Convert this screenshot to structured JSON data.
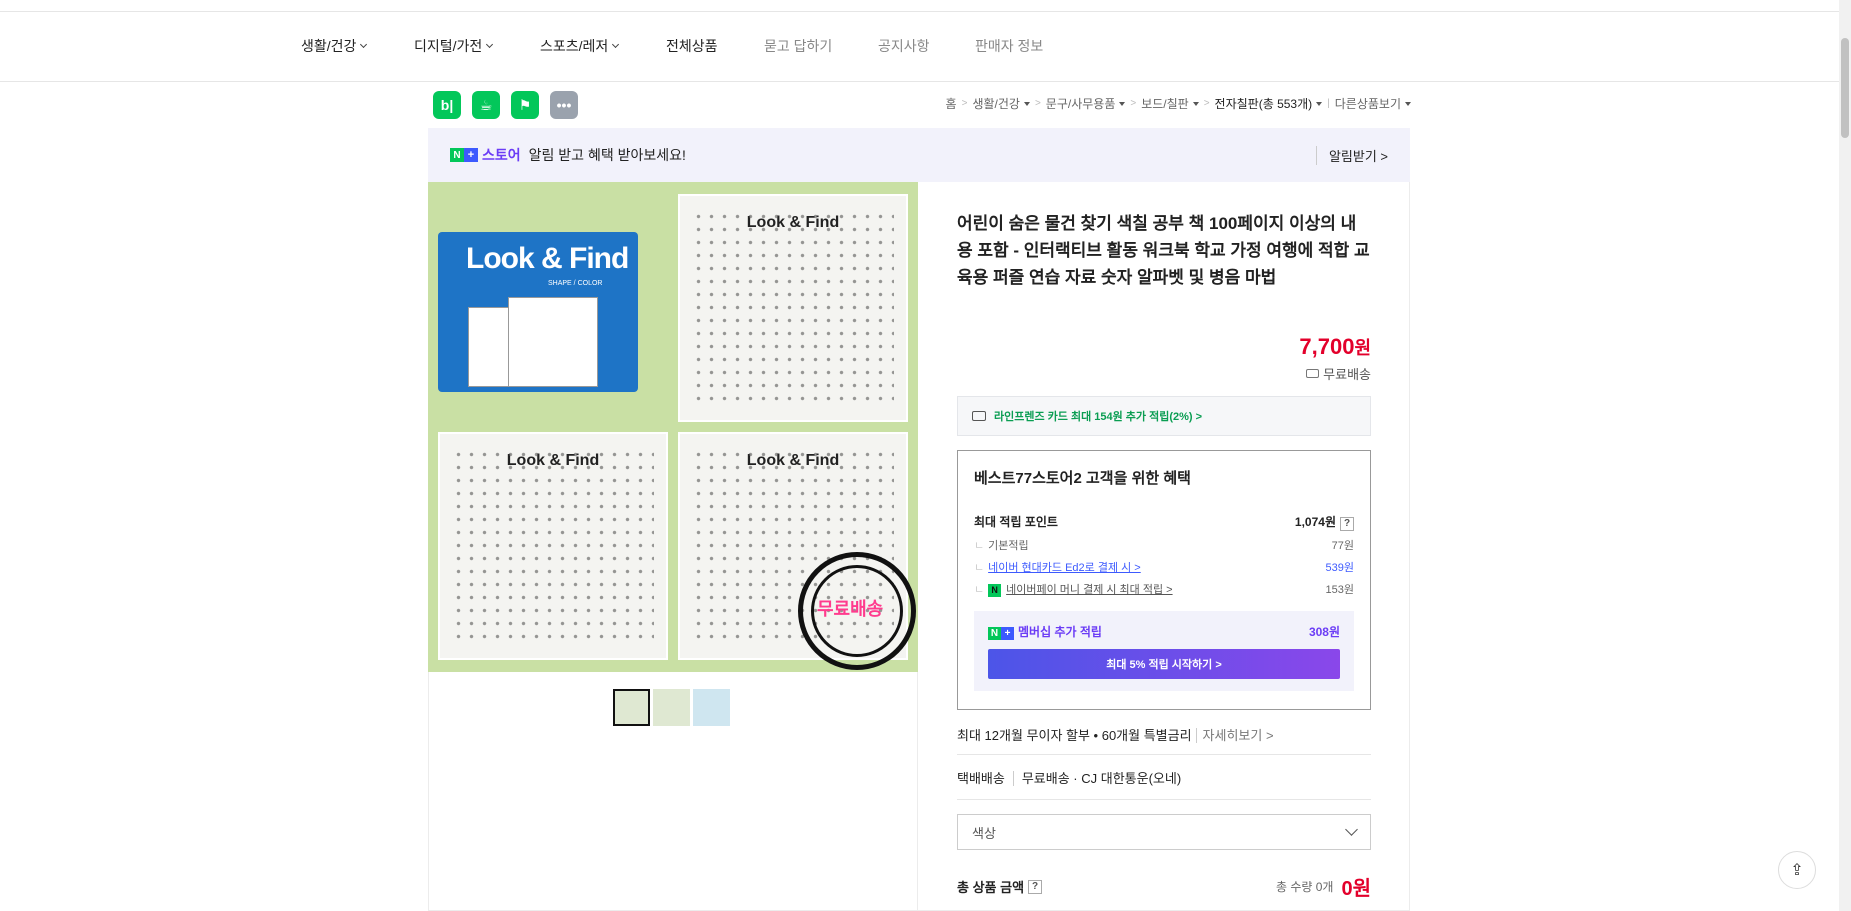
{
  "nav": {
    "items": [
      {
        "label": "생활/건강",
        "dropdown": true
      },
      {
        "label": "디지털/가전",
        "dropdown": true
      },
      {
        "label": "스포츠/레저",
        "dropdown": true
      },
      {
        "label": "전체상품",
        "dropdown": false
      },
      {
        "label": "묻고 답하기",
        "dropdown": false
      },
      {
        "label": "공지사항",
        "dropdown": false
      },
      {
        "label": "판매자 정보",
        "dropdown": false
      }
    ]
  },
  "share_icons": [
    "blog-share-icon",
    "cafe-share-icon",
    "bookmark-icon",
    "more-icon"
  ],
  "breadcrumb": {
    "home": "홈",
    "c1": "생활/건강",
    "c2": "문구/사무용품",
    "c3": "보드/칠판",
    "c4": "전자칠판(총 553개)",
    "other": "다른상품보기"
  },
  "alert": {
    "store": "스토어",
    "message": "알림 받고 혜택 받아보세요!",
    "action": "알림받기 >"
  },
  "product": {
    "image_title": "Look & Find",
    "image_subtitle": "SHAPE / COLOR",
    "image_badge": "무료배송",
    "title": "어린이 숨은 물건 찾기 색칠 공부 책 100페이지 이상의 내용 포함 - 인터랙티브 활동 워크북 학교 가정 여행에 적합 교육용 퍼즐 연습 자료 숫자 알파벳 및 병음 마법",
    "price": "7,700",
    "currency": "원",
    "shipping": "무료배송",
    "card_benefit": "라인프렌즈 카드 최대 154원 추가 적립(2%) >"
  },
  "benefit": {
    "heading": "베스트77스토어2 고객을 위한 혜택",
    "max_label": "최대 적립 포인트",
    "max_value": "1,074원",
    "help": "?",
    "rows": [
      {
        "label": "기본적립",
        "value": "77원"
      },
      {
        "label": "네이버 현대카드 Ed2로 결제 시 >",
        "value": "539원"
      },
      {
        "label": "네이버페이 머니 결제 시 최대 적립 >",
        "value": "153원"
      }
    ],
    "membership_label": "멤버십 추가 적립",
    "membership_value": "308원",
    "membership_button": "최대 5% 적립 시작하기 >"
  },
  "installment": {
    "text": "최대 12개월 무이자 할부 • 60개월 특별금리",
    "link": "자세히보기 >"
  },
  "delivery": {
    "type": "택배배송",
    "detail": "무료배송 · CJ 대한통운(오네)"
  },
  "option": {
    "placeholder": "색상"
  },
  "total": {
    "label": "총 상품 금액",
    "help": "?",
    "qty": "총 수량 0개",
    "sum": "0원"
  },
  "colors": {
    "naver_green": "#03c75a",
    "price_red": "#e3002b",
    "purple": "#6b3cf6"
  }
}
